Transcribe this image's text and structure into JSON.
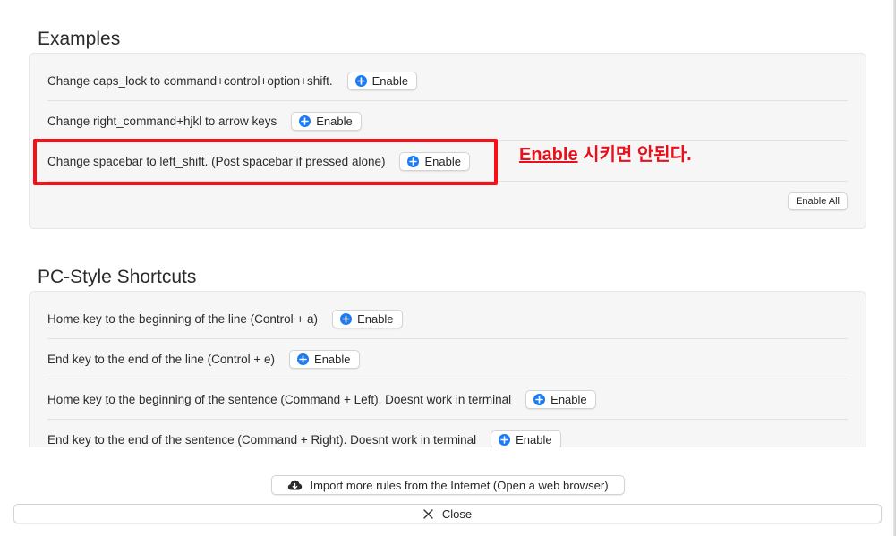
{
  "examples": {
    "title": "Examples",
    "rows": [
      {
        "label": "Change caps_lock to command+control+option+shift.",
        "button": "Enable"
      },
      {
        "label": "Change right_command+hjkl to arrow keys",
        "button": "Enable"
      },
      {
        "label": "Change spacebar to left_shift. (Post spacebar if pressed alone)",
        "button": "Enable"
      }
    ],
    "enable_all": "Enable All"
  },
  "pc_style": {
    "title": "PC-Style Shortcuts",
    "rows": [
      {
        "label": "Home key to the beginning of the line (Control + a)",
        "button": "Enable"
      },
      {
        "label": "End key to the end of the line (Control + e)",
        "button": "Enable"
      },
      {
        "label": "Home key to the beginning of the sentence (Command + Left). Doesnt work in terminal",
        "button": "Enable"
      },
      {
        "label": "End key to the end of the sentence (Command + Right). Doesnt work in terminal",
        "button": "Enable"
      }
    ]
  },
  "annotation": {
    "emphasis": "Enable",
    "rest": " 시키면 안된다."
  },
  "footer": {
    "import_label": "Import more rules from the Internet (Open a web browser)",
    "close_label": "Close"
  },
  "icons": {
    "enable": "plus-circle-icon",
    "import": "cloud-download-icon",
    "close": "close-icon"
  },
  "colors": {
    "accent": "#1a7cf5",
    "annotation_red": "#e8101a"
  }
}
